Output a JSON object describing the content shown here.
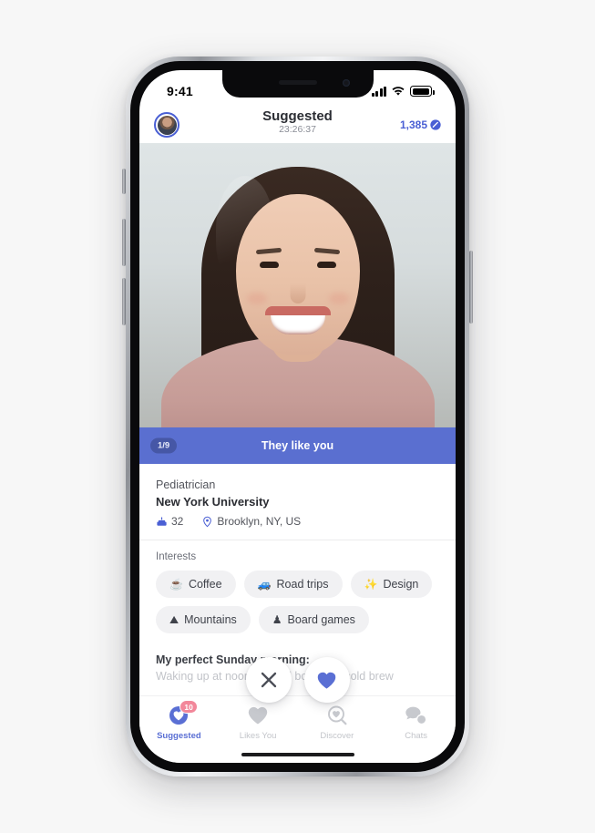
{
  "status_bar": {
    "time": "9:41",
    "signal_icon": "cellular-bars-icon",
    "wifi_icon": "wifi-icon",
    "battery_icon": "battery-icon"
  },
  "header": {
    "avatar_name": "profile-avatar",
    "title": "Suggested",
    "timer": "23:26:37",
    "count": "1,385",
    "count_icon": "verified-badge-icon"
  },
  "photo": {
    "name": "profile-photo"
  },
  "banner": {
    "counter": "1/9",
    "text": "They like you",
    "color": "#5a6fd0"
  },
  "profile": {
    "role": "Pediatrician",
    "school": "New York University",
    "age": "32",
    "age_icon": "birthday-cake-icon",
    "location": "Brooklyn, NY, US",
    "location_icon": "map-pin-icon"
  },
  "interests": {
    "title": "Interests",
    "chips": [
      {
        "emoji": "☕",
        "label": "Coffee",
        "icon": "coffee-icon"
      },
      {
        "emoji": "🚙",
        "label": "Road trips",
        "icon": "car-icon"
      },
      {
        "emoji": "✨",
        "label": "Design",
        "icon": "sparkles-icon"
      },
      {
        "emoji": "⛰",
        "label": "Mountains",
        "icon": "mountain-icon"
      },
      {
        "emoji": "♟",
        "label": "Board games",
        "icon": "chess-pawn-icon"
      }
    ]
  },
  "bio": {
    "question": "My perfect Sunday morning:",
    "answer": "Waking up at noon, a good book and cold brew"
  },
  "actions": {
    "pass_label": "pass",
    "pass_icon": "close-icon",
    "like_label": "like",
    "like_icon": "heart-icon",
    "like_color": "#5a6fd4"
  },
  "tabbar": {
    "tabs": [
      {
        "label": "Suggested",
        "icon": "heart-circle-icon",
        "active": true,
        "badge": "10"
      },
      {
        "label": "Likes You",
        "icon": "heart-icon",
        "active": false,
        "badge": ""
      },
      {
        "label": "Discover",
        "icon": "heart-search-icon",
        "active": false,
        "badge": ""
      },
      {
        "label": "Chats",
        "icon": "chat-bubbles-icon",
        "active": false,
        "badge": ""
      }
    ]
  }
}
